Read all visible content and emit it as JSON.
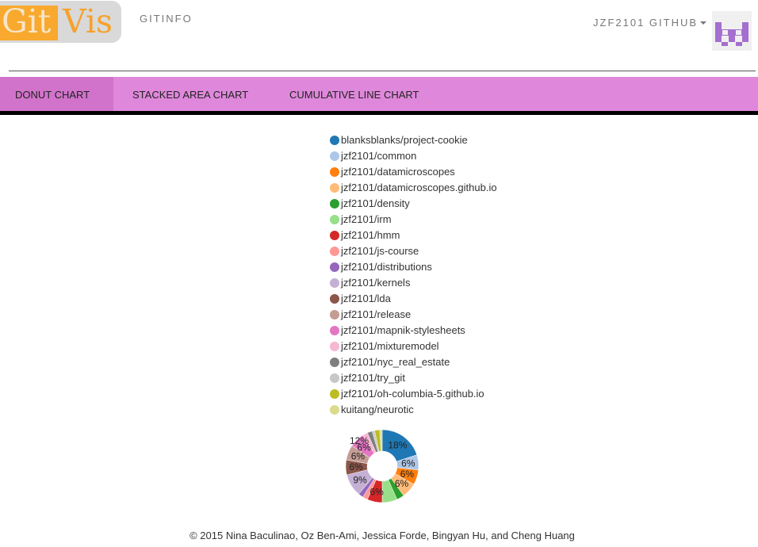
{
  "header": {
    "logo": {
      "word1": "Git",
      "word2": "Vis"
    },
    "brand": "GITINFO",
    "github_link": "JZF2101 GITHUB"
  },
  "tabs": [
    {
      "label": "DONUT CHART",
      "active": true
    },
    {
      "label": "STACKED AREA CHART",
      "active": false
    },
    {
      "label": "CUMULATIVE LINE CHART",
      "active": false
    }
  ],
  "footer": "© 2015 Nina Baculinao, Oz Ben-Ami, Jessica Forde, Bingyan Hu, and Cheng Huang",
  "chart_data": {
    "type": "pie",
    "variant": "donut",
    "legend_position": "top",
    "categories": [
      "blanksblanks/project-cookie",
      "jzf2101/common",
      "jzf2101/datamicroscopes",
      "jzf2101/datamicroscopes.github.io",
      "jzf2101/density",
      "jzf2101/irm",
      "jzf2101/hmm",
      "jzf2101/js-course",
      "jzf2101/distributions",
      "jzf2101/kernels",
      "jzf2101/lda",
      "jzf2101/release",
      "jzf2101/mapnik-stylesheets",
      "jzf2101/mixturemodel",
      "jzf2101/nyc_real_estate",
      "jzf2101/try_git",
      "jzf2101/oh-columbia-5.github.io",
      "kuitang/neurotic"
    ],
    "colors": [
      "#1f77b4",
      "#aec7e8",
      "#ff7f0e",
      "#ffbb78",
      "#2ca02c",
      "#98df8a",
      "#d62728",
      "#ff9896",
      "#9467bd",
      "#c5b0d5",
      "#8c564b",
      "#c49c94",
      "#e377c2",
      "#f7b6d2",
      "#7f7f7f",
      "#c7c7c7",
      "#bcbd22",
      "#dbdb8d"
    ],
    "values": [
      18,
      6,
      6,
      6,
      3,
      6,
      6,
      2,
      2,
      9,
      6,
      6,
      6,
      2,
      2,
      1,
      2,
      1
    ],
    "labels": [
      "18%",
      "6%",
      "6%",
      "6%",
      "",
      "",
      "6%",
      "",
      "",
      "9%",
      "6%",
      "6%",
      "6%",
      "",
      "",
      "",
      "",
      ""
    ],
    "label_extra": "12%"
  }
}
